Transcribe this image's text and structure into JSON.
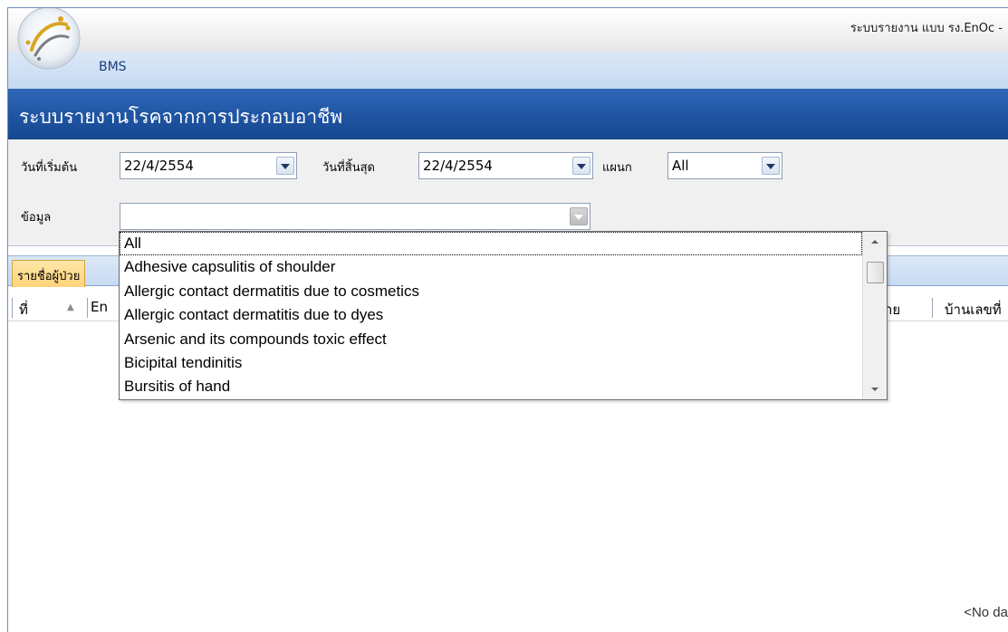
{
  "window": {
    "title": "ระบบรายงาน แบบ รง.EnOc -",
    "app_name": "BMS"
  },
  "header": {
    "title": "ระบบรายงานโรคจากการประกอบอาชีพ"
  },
  "filters": {
    "start_date_label": "วันที่เริ่มต้น",
    "start_date_value": "22/4/2554",
    "end_date_label": "วันที่สิ้นสุด",
    "end_date_value": "22/4/2554",
    "department_label": "แผนก",
    "department_value": "All",
    "data_label": "ข้อมูล",
    "data_value": ""
  },
  "dropdown": {
    "items": [
      "All",
      "Adhesive capsulitis of shoulder",
      "Allergic contact dermatitis due to cosmetics",
      "Allergic contact dermatitis due to dyes",
      "Arsenic and its compounds toxic effect",
      "Bicipital tendinitis",
      "Bursitis of hand"
    ],
    "selected_index": 0
  },
  "tabs": [
    {
      "label": "รายชื่อผู้ป่วย",
      "active": true
    }
  ],
  "grid": {
    "columns": [
      "ที่",
      "En",
      "าย",
      "บ้านเลขที่"
    ],
    "empty_text": "<No da"
  },
  "colors": {
    "header_band": "#1f54a2",
    "tab_active": "#ffd37a",
    "appbar": "#cfe0f4"
  }
}
